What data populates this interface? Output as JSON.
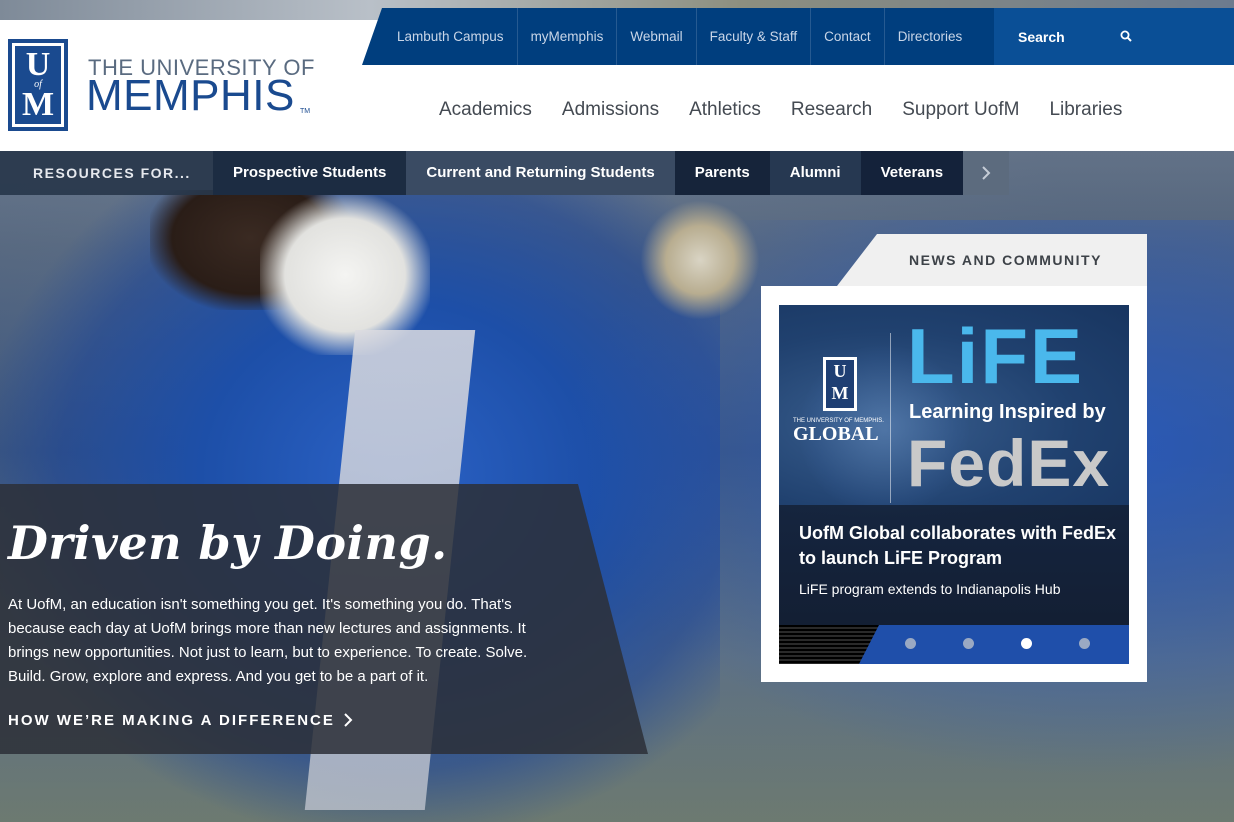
{
  "brand": {
    "line1": "THE UNIVERSITY OF",
    "line2": "MEMPHIS",
    "tm": "TM",
    "mark_top": "U",
    "mark_mid": "of",
    "mark_bottom": "M",
    "primary_color": "#003e7e"
  },
  "utility_nav": {
    "items": [
      "Lambuth Campus",
      "myMemphis",
      "Webmail",
      "Faculty & Staff",
      "Contact",
      "Directories"
    ],
    "search_label": "Search",
    "search_icon": "search-icon"
  },
  "main_nav": {
    "items": [
      "Academics",
      "Admissions",
      "Athletics",
      "Research",
      "Support UofM",
      "Libraries"
    ]
  },
  "resources": {
    "label": "RESOURCES FOR...",
    "items": [
      "Prospective Students",
      "Current and Returning Students",
      "Parents",
      "Alumni",
      "Veterans"
    ],
    "next_icon": "chevron-right-icon"
  },
  "hero": {
    "title": "Driven by Doing.",
    "body": "At UofM, an education isn't something you get. It's something you do. That's because each day at UofM brings more than new lectures and assignments. It brings new opportunities. Not just to learn, but to experience. To create. Solve. Build. Grow, explore and express. And you get to be a part of it.",
    "link": "HOW WE’RE MAKING A DIFFERENCE",
    "link_icon": "chevron-right-icon"
  },
  "news": {
    "tab_label": "NEWS AND COMMUNITY",
    "slide": {
      "image_logo_small": "THE UNIVERSITY OF MEMPHIS.",
      "image_logo_global": "GLOBAL",
      "image_mark_top": "U",
      "image_mark_bottom": "M",
      "image_title": "LiFE",
      "image_subtitle": "Learning Inspired by",
      "image_brand": "FedEx",
      "headline": "UofM Global collaborates with FedEx to launch LiFE Program",
      "subtitle": "LiFE program extends to Indianapolis Hub"
    },
    "dots_count": 4,
    "active_dot": 3
  }
}
